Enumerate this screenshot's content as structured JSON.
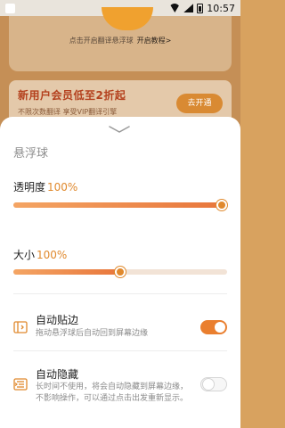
{
  "status_bar": {
    "time": "10:57"
  },
  "background": {
    "tip_text": "点击开启翻译悬浮球",
    "tip_link": "开启教程>",
    "promo_title": "新用户会员低至2折起",
    "promo_sub": "不限次数翻译 享受VIP翻译引擎",
    "promo_button": "去开通"
  },
  "sheet": {
    "title": "悬浮球",
    "opacity": {
      "label": "透明度",
      "value_text": "100%",
      "value": 1.0
    },
    "size": {
      "label": "大小",
      "value_text": "100%",
      "value": 0.5
    },
    "auto_snap": {
      "title": "自动贴边",
      "desc": "拖动悬浮球后自动回到屏幕边缘",
      "enabled": true,
      "icon": "snap-edge-icon"
    },
    "auto_hide": {
      "title": "自动隐藏",
      "desc": "长时间不使用，将会自动隐藏到屏幕边缘，不影响操作，可以通过点击出发重新显示。",
      "enabled": false,
      "icon": "auto-hide-icon"
    }
  },
  "colors": {
    "accent": "#e0892d",
    "toggle_on": "#ea7f2f"
  }
}
